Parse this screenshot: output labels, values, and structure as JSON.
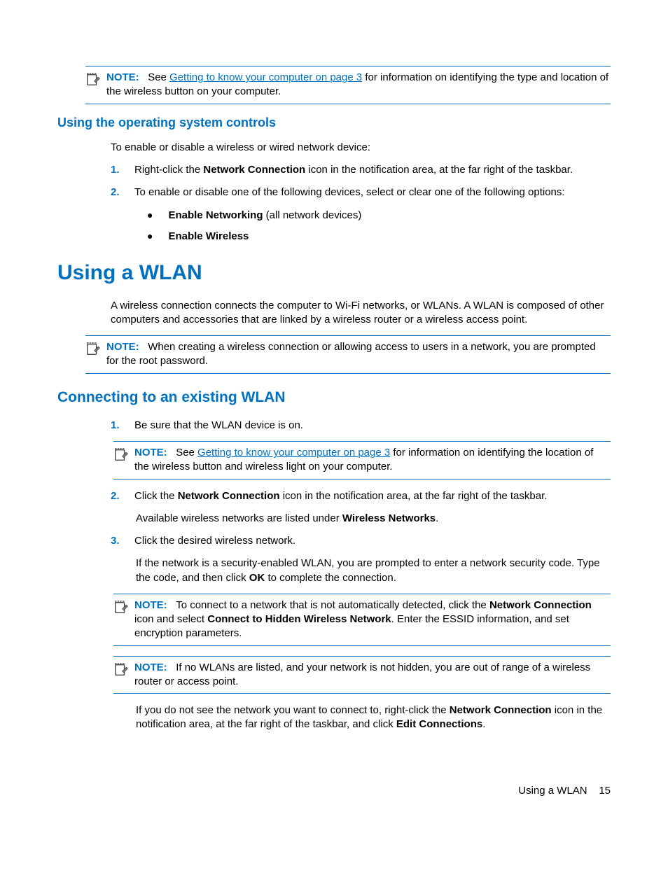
{
  "note1": {
    "label": "NOTE:",
    "pre": "See ",
    "link": "Getting to know your computer on page 3",
    "post": " for information on identifying the type and location of the wireless button on your computer."
  },
  "h3_os_controls": "Using the operating system controls",
  "os_intro": "To enable or disable a wireless or wired network device:",
  "step1": {
    "num": "1.",
    "pre": "Right-click the ",
    "bold": "Network Connection",
    "post": " icon in the notification area, at the far right of the taskbar."
  },
  "step2": {
    "num": "2.",
    "text": "To enable or disable one of the following devices, select or clear one of the following options:"
  },
  "bullet1": {
    "bold": "Enable Networking",
    "rest": " (all network devices)"
  },
  "bullet2": {
    "bold": "Enable Wireless"
  },
  "h1_wlan": "Using a WLAN",
  "wlan_intro": "A wireless connection connects the computer to Wi-Fi networks, or WLANs. A WLAN is composed of other computers and accessories that are linked by a wireless router or a wireless access point.",
  "note2": {
    "label": "NOTE:",
    "text": "When creating a wireless connection or allowing access to users in a network, you are prompted for the root password."
  },
  "h2_connecting": "Connecting to an existing WLAN",
  "cstep1": {
    "num": "1.",
    "text": "Be sure that the WLAN device is on."
  },
  "note3": {
    "label": "NOTE:",
    "pre": "See ",
    "link": "Getting to know your computer on page 3",
    "post": " for information on identifying the location of the wireless button and wireless light on your computer."
  },
  "cstep2": {
    "num": "2.",
    "pre": "Click the ",
    "bold": "Network Connection",
    "post": " icon in the notification area, at the far right of the taskbar."
  },
  "cstep2_sub": {
    "pre": "Available wireless networks are listed under ",
    "bold": "Wireless Networks",
    "post": "."
  },
  "cstep3": {
    "num": "3.",
    "text": "Click the desired wireless network."
  },
  "cstep3_sub": {
    "pre": "If the network is a security-enabled WLAN, you are prompted to enter a network security code. Type the code, and then click ",
    "bold": "OK",
    "post": " to complete the connection."
  },
  "note4": {
    "label": "NOTE:",
    "pre": "To connect to a network that is not automatically detected, click the ",
    "b1": "Network Connection",
    "mid": " icon and select ",
    "b2": "Connect to Hidden Wireless Network",
    "post": ". Enter the ESSID information, and set encryption parameters."
  },
  "note5": {
    "label": "NOTE:",
    "text": "If no WLANs are listed, and your network is not hidden, you are out of range of a wireless router or access point."
  },
  "final_para": {
    "pre": "If you do not see the network you want to connect to, right-click the ",
    "b1": "Network Connection",
    "mid": " icon in the notification area, at the far right of the taskbar, and click ",
    "b2": "Edit Connections",
    "post": "."
  },
  "footer": {
    "text": "Using a WLAN",
    "page": "15"
  }
}
